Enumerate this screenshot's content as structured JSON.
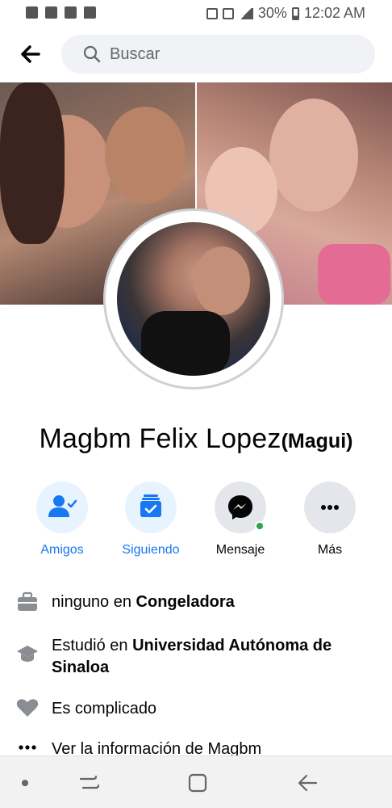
{
  "status_bar": {
    "battery": "30%",
    "time": "12:02 AM"
  },
  "search": {
    "placeholder": "Buscar"
  },
  "profile": {
    "name": "Magbm Felix Lopez",
    "nickname": "(Magui)"
  },
  "actions": [
    {
      "label": "Amigos",
      "icon": "friends-check-icon"
    },
    {
      "label": "Siguiendo",
      "icon": "following-check-icon"
    },
    {
      "label": "Mensaje",
      "icon": "messenger-icon"
    },
    {
      "label": "Más",
      "icon": "more-icon"
    }
  ],
  "info": {
    "work_prefix": "ninguno en ",
    "work_place": "Congeladora",
    "study_prefix": "Estudió en ",
    "study_place": "Universidad Autónoma de Sinaloa",
    "relationship": "Es complicado",
    "see_more": "Ver la información de Magbm"
  },
  "colors": {
    "accent": "#1877f2",
    "accent_bg": "#e7f3ff",
    "online": "#31a24c"
  }
}
